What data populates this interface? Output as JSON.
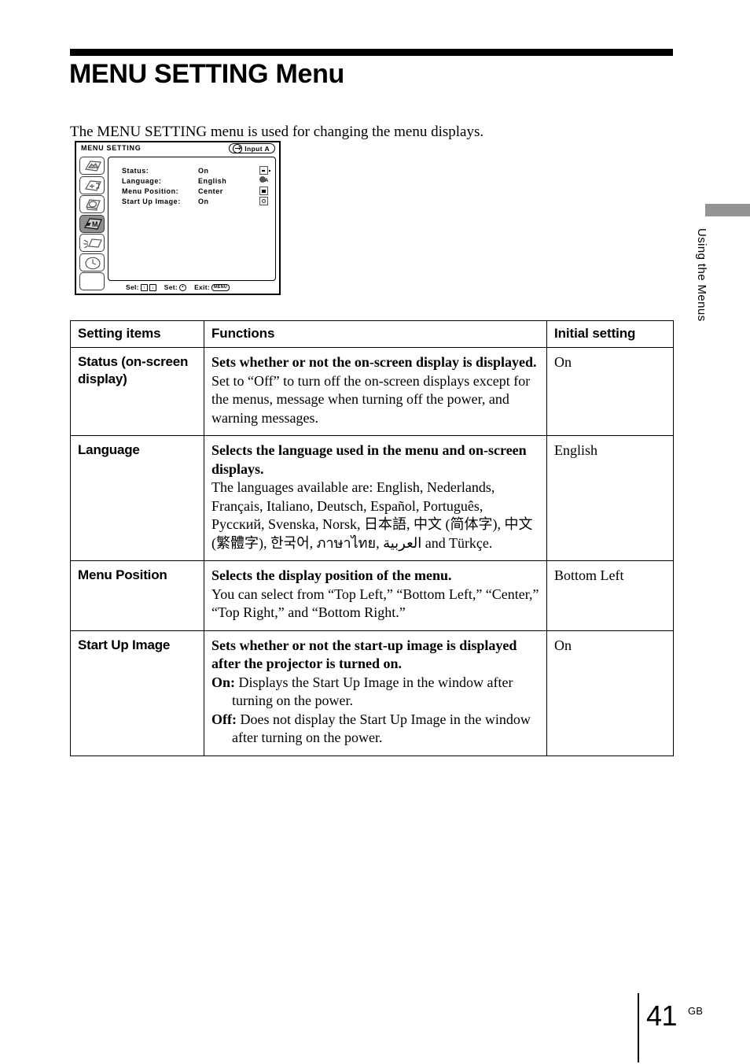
{
  "page": {
    "title": "MENU SETTING Menu",
    "intro": "The MENU SETTING menu is used for changing the menu displays.",
    "number": "41",
    "number_suffix": "GB",
    "side_tab_label": "Using the Menus",
    "tab_color": "#949494"
  },
  "osd": {
    "title": "MENU SETTING",
    "input_label": "Input A",
    "rows": [
      {
        "label": "Status:",
        "value": "On",
        "icon": "status-indicator-icon"
      },
      {
        "label": "Language:",
        "value": "English",
        "icon": "language-globe-icon"
      },
      {
        "label": "Menu Position:",
        "value": "Center",
        "icon": "menu-position-icon"
      },
      {
        "label": "Start Up Image:",
        "value": "On",
        "icon": "start-up-image-icon"
      }
    ],
    "icon_bar": [
      {
        "name": "picture-menu-icon",
        "selected": false
      },
      {
        "name": "input-setting-menu-icon",
        "selected": false
      },
      {
        "name": "setup-menu-icon",
        "selected": false
      },
      {
        "name": "menu-setting-menu-icon",
        "selected": true
      },
      {
        "name": "installation-menu-icon",
        "selected": false
      },
      {
        "name": "information-menu-icon",
        "selected": false
      },
      {
        "name": "blank-menu-icon",
        "selected": false
      }
    ],
    "footer": {
      "select_label": "Sel:",
      "select_key_up": "↑",
      "select_key_down": "↓",
      "set_label": "Set:",
      "set_key": "•",
      "exit_label": "Exit:",
      "exit_key": "MENU"
    }
  },
  "table": {
    "headers": [
      "Setting items",
      "Functions",
      "Initial setting"
    ],
    "rows": [
      {
        "item": "Status (on-screen display)",
        "lead": "Sets whether or not the on-screen display is displayed.",
        "body": "Set to “Off” to turn off the on-screen displays except for the menus, message when turning off the power, and warning messages.",
        "initial": "On"
      },
      {
        "item": "Language",
        "lead": "Selects the language used in the menu and on-screen displays.",
        "body": "The languages available are: English, Nederlands, Français, Italiano, Deutsch, Español, Português, Русский, Svenska, Norsk, 日本語, 中文 (简体字), 中文 (繁體字), 한국어, ภาษาไทย, العربية and Türkçe.",
        "initial": "English"
      },
      {
        "item": "Menu Position",
        "lead": "Selects the display position of the menu.",
        "body": "You can select  from “Top Left,” “Bottom Left,” “Center,” “Top Right,” and “Bottom Right.”",
        "initial": "Bottom Left"
      },
      {
        "item": "Start Up Image",
        "lead": "Sets whether or not the start-up image is displayed after the projector is turned on.",
        "body_items": [
          {
            "term": "On:",
            "text": " Displays the Start Up Image in the window after turning on the power."
          },
          {
            "term": "Off:",
            "text": " Does not display the Start Up Image in the window after turning on the power."
          }
        ],
        "initial": "On"
      }
    ]
  }
}
